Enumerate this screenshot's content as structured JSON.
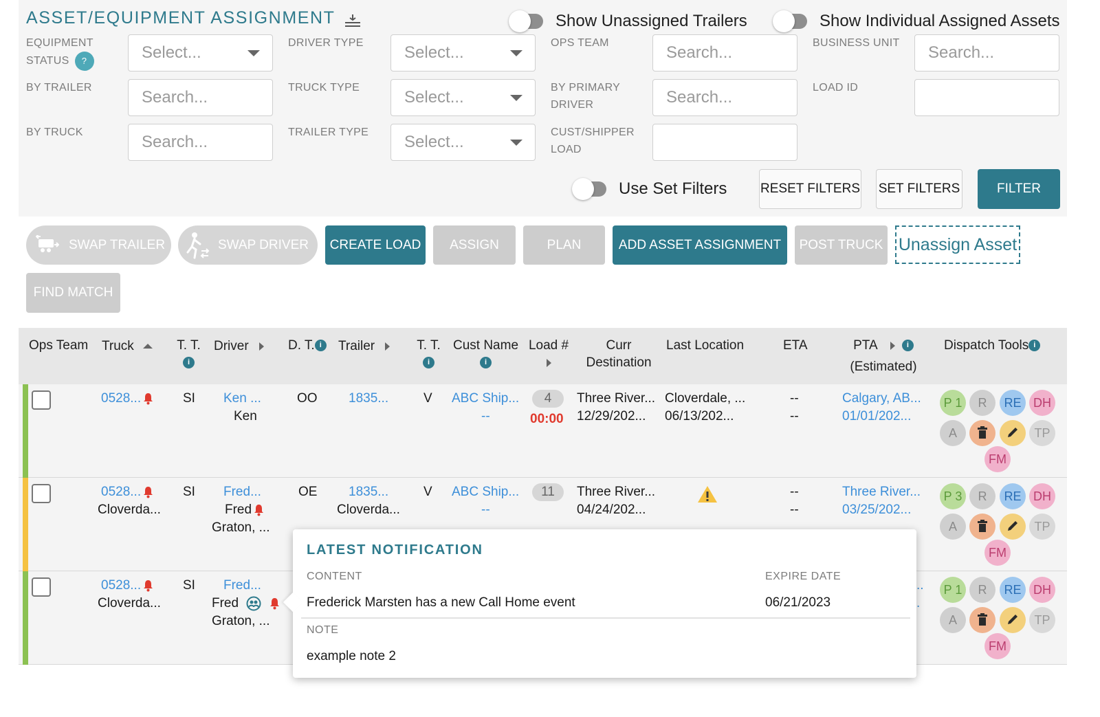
{
  "header": {
    "title": "ASSET/EQUIPMENT ASSIGNMENT",
    "toggle_unassigned_trailers": "Show Unassigned Trailers",
    "toggle_individual_assets": "Show Individual Assigned Assets"
  },
  "filters": {
    "equipment_status": {
      "label_line1": "EQUIPMENT",
      "label_line2": "STATUS",
      "help": "?",
      "placeholder": "Select..."
    },
    "driver_type": {
      "label": "DRIVER TYPE",
      "placeholder": "Select..."
    },
    "ops_team": {
      "label": "OPS TEAM",
      "placeholder": "Search..."
    },
    "business_unit": {
      "label": "BUSINESS UNIT",
      "placeholder": "Search..."
    },
    "by_trailer": {
      "label": "BY TRAILER",
      "placeholder": "Search..."
    },
    "truck_type": {
      "label": "TRUCK TYPE",
      "placeholder": "Select..."
    },
    "by_primary_driver": {
      "label_line1": "BY PRIMARY",
      "label_line2": "DRIVER",
      "placeholder": "Search..."
    },
    "load_id": {
      "label": "LOAD ID",
      "value": ""
    },
    "by_truck": {
      "label": "BY TRUCK",
      "placeholder": "Search..."
    },
    "trailer_type": {
      "label": "TRAILER TYPE",
      "placeholder": "Select..."
    },
    "cust_shipper_load": {
      "label_line1": "CUST/SHIPPER",
      "label_line2": "LOAD",
      "value": ""
    },
    "use_set_filters": "Use Set Filters",
    "reset_filters": "RESET FILTERS",
    "set_filters": "SET FILTERS",
    "filter": "FILTER"
  },
  "actions": {
    "swap_trailer": "SWAP TRAILER",
    "swap_driver": "SWAP DRIVER",
    "create_load": "CREATE LOAD",
    "assign": "ASSIGN",
    "plan": "PLAN",
    "add_asset_assignment": "ADD ASSET ASSIGNMENT",
    "post_truck": "POST TRUCK",
    "unassign_asset": "Unassign Asset",
    "find_match": "FIND MATCH"
  },
  "columns": {
    "ops_team": "Ops Team",
    "truck": "Truck",
    "truck_type": "T. T.",
    "driver": "Driver",
    "driver_type": "D. T.",
    "trailer": "Trailer",
    "trailer_type": "T. T.",
    "cust_name": "Cust Name",
    "load_num": "Load #",
    "curr_destination_1": "Curr",
    "curr_destination_2": "Destination",
    "last_location": "Last Location",
    "eta": "ETA",
    "pta_1": "PTA",
    "pta_2": "(Estimated)",
    "dispatch_tools": "Dispatch Tools"
  },
  "rows": [
    {
      "status_color": "#8cc152",
      "truck": "0528...",
      "truck_sub": "",
      "truck_type": "SI",
      "driver": "Ken ...",
      "driver_sub1": "Ken",
      "driver_sub2": "",
      "driver_type": "OO",
      "trailer": "1835...",
      "trailer_sub": "",
      "trailer_type": "V",
      "cust_name": "ABC Ship...",
      "cust_sub": "--",
      "load_num": "4",
      "load_time": "00:00",
      "curr_dest": "Three River...",
      "curr_dest_date": "12/29/202...",
      "last_location": "Cloverdale, ...",
      "last_location_date": "06/13/202...",
      "eta_1": "--",
      "eta_2": "--",
      "pta": "Calgary, AB...",
      "pta_date": "01/01/202...",
      "tools": {
        "p": "P 1",
        "r": "R",
        "re": "RE",
        "dh": "DH",
        "a": "A",
        "tp": "TP",
        "fm": "FM"
      }
    },
    {
      "status_color": "#f5c242",
      "truck": "0528...",
      "truck_sub": "Cloverda...",
      "truck_type": "SI",
      "driver": "Fred...",
      "driver_sub1": "Fred",
      "driver_sub2": "Graton, ...",
      "driver_type": "OE",
      "trailer": "1835...",
      "trailer_sub": "Cloverda...",
      "trailer_type": "V",
      "cust_name": "ABC Ship...",
      "cust_sub": "--",
      "load_num": "11",
      "load_time": "",
      "curr_dest": "Three River...",
      "curr_dest_date": "04/24/202...",
      "last_location": "",
      "last_location_date": "",
      "eta_1": "--",
      "eta_2": "--",
      "pta": "Three River...",
      "pta_date": "03/25/202...",
      "tools": {
        "p": "P 3",
        "r": "R",
        "re": "RE",
        "dh": "DH",
        "a": "A",
        "tp": "TP",
        "fm": "FM"
      }
    },
    {
      "status_color": "#8cc152",
      "truck": "0528...",
      "truck_sub": "Cloverda...",
      "truck_type": "SI",
      "driver": "Fred...",
      "driver_sub1": "Fred",
      "driver_sub2": "Graton, ...",
      "pta_partial_1": "..",
      "pta_partial_2": ".",
      "tools": {
        "p": "P 1",
        "r": "R",
        "re": "RE",
        "dh": "DH",
        "a": "A",
        "tp": "TP",
        "fm": "FM"
      }
    }
  ],
  "popover": {
    "title": "LATEST NOTIFICATION",
    "content_label": "CONTENT",
    "expire_label": "EXPIRE DATE",
    "content": "Frederick Marsten has a new Call Home event",
    "expire_date": "06/21/2023",
    "note_label": "NOTE",
    "note": "example note 2"
  }
}
